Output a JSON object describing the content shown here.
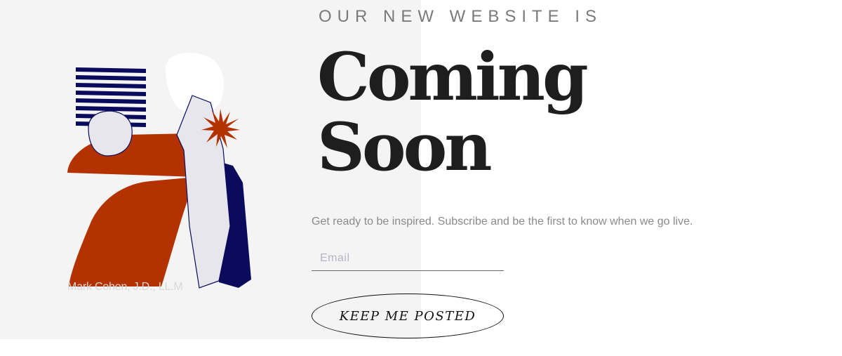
{
  "hero": {
    "kicker": "OUR NEW WEBSITE IS",
    "headline_line1": "Coming",
    "headline_line2": "Soon",
    "subtext": "Get ready to be inspired. Subscribe and be the first to know when we go live."
  },
  "signup": {
    "email_placeholder": "Email",
    "email_value": "",
    "submit_label": "KEEP ME POSTED"
  },
  "artwork": {
    "signature": "Mark Cohen, J.D., LL.M",
    "colors": {
      "navy": "#0b0b5e",
      "rust": "#b33200",
      "light_gray": "#e6e6ec",
      "white": "#ffffff"
    }
  }
}
